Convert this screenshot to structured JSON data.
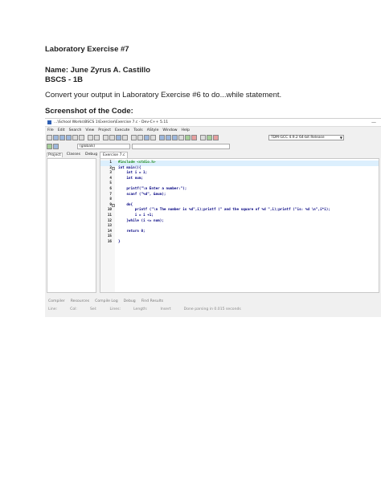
{
  "document": {
    "heading": "Laboratory Exercise #7",
    "name_line": "Name: June Zyrus A. Castillo",
    "section_line": "BSCS - 1B",
    "instruction": "Convert your output in Laboratory Exercise #6 to do...while statement.",
    "screenshot_label": "Screenshot of the Code:"
  },
  "screenshot": {
    "window_title": "...\\School Works\\BSCS 1\\Exercise\\Exercise 7.c - Dev-C++ 5.11",
    "minimize_glyph": "—",
    "menu": [
      "File",
      "Edit",
      "Search",
      "View",
      "Project",
      "Execute",
      "Tools",
      "AStyle",
      "Window",
      "Help"
    ],
    "compiler": "TDM-GCC 4.9.2 64-bit Release",
    "scope": "(globals)",
    "side_tabs": [
      "Project",
      "Classes",
      "Debug"
    ],
    "editor_tab": "Exercise 7.c",
    "code_lines": [
      {
        "n": "1",
        "text": "#include <stdio.h>"
      },
      {
        "n": "2",
        "text": "int main(){",
        "fold": "−"
      },
      {
        "n": "3",
        "text": "    int i = 1;"
      },
      {
        "n": "4",
        "text": "    int num;"
      },
      {
        "n": "5",
        "text": ""
      },
      {
        "n": "6",
        "text": "    printf(\"\\n Enter a number:\");"
      },
      {
        "n": "7",
        "text": "    scanf (\"%d\", &num);"
      },
      {
        "n": "8",
        "text": ""
      },
      {
        "n": "9",
        "text": "    do{",
        "fold": "−"
      },
      {
        "n": "10",
        "text": "        printf (\"\\n The number is %d\",i);printf (\" and the square of %d \",i);printf (\"is: %d \\n\",i*i);"
      },
      {
        "n": "11",
        "text": "        i = i +1;"
      },
      {
        "n": "12",
        "text": "    }while (i <= num);"
      },
      {
        "n": "13",
        "text": ""
      },
      {
        "n": "14",
        "text": "    return 0;"
      },
      {
        "n": "15",
        "text": ""
      },
      {
        "n": "16",
        "text": "}"
      }
    ],
    "bottom_tabs": [
      "Compiler",
      "Resources",
      "Compile Log",
      "Debug",
      "Find Results"
    ],
    "status": [
      "Line:",
      "Col:",
      "Sel:",
      "Lines:",
      "Length:",
      "Insert",
      "Done parsing in 0.015 seconds"
    ]
  }
}
